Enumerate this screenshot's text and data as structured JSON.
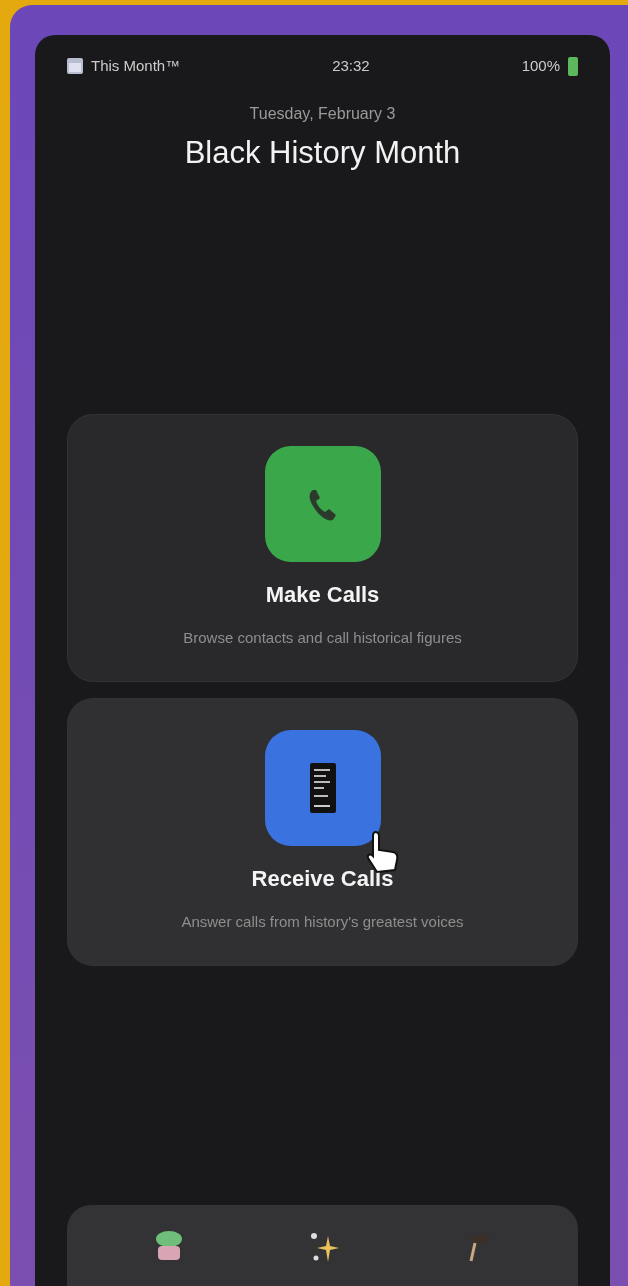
{
  "status_bar": {
    "app_label": "This Month™",
    "time": "23:32",
    "battery": "100%"
  },
  "header": {
    "date": "Tuesday, February 3",
    "title": "Black History Month"
  },
  "cards": [
    {
      "kind": "phone",
      "title": "Make Calls",
      "subtitle": "Browse contacts and call historical figures",
      "hovered": false
    },
    {
      "kind": "tablet",
      "title": "Receive Calls",
      "subtitle": "Answer calls from history's greatest voices",
      "hovered": true
    }
  ]
}
